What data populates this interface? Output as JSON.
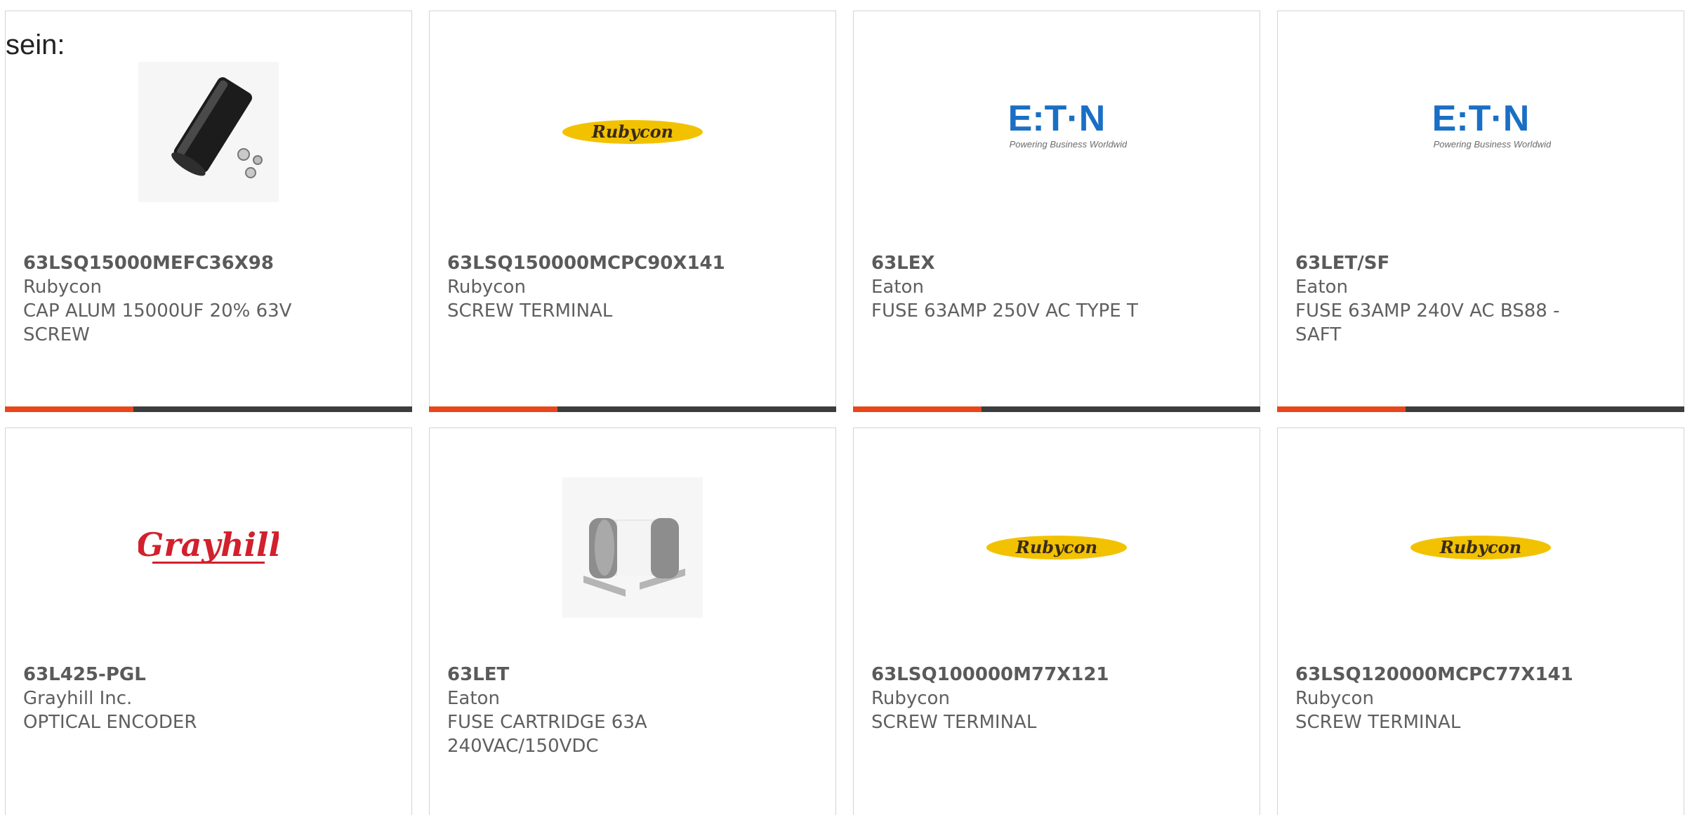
{
  "lead_text": "sein:",
  "products": [
    {
      "part": "63LSQ15000MEFC36X98",
      "manufacturer": "Rubycon",
      "description": "CAP ALUM 15000UF 20% 63V SCREW",
      "image": "capacitor-photo"
    },
    {
      "part": "63LSQ150000MCPC90X141",
      "manufacturer": "Rubycon",
      "description": "SCREW TERMINAL",
      "image": "rubycon-logo",
      "logo_text": "Rubycon"
    },
    {
      "part": "63LEX",
      "manufacturer": "Eaton",
      "description": "FUSE 63AMP 250V AC TYPE T",
      "image": "eaton-logo",
      "logo_text": "E:T·N",
      "logo_tagline": "Powering Business Worldwide"
    },
    {
      "part": "63LET/SF",
      "manufacturer": "Eaton",
      "description": "FUSE 63AMP 240V AC BS88 - SAFT",
      "image": "eaton-logo",
      "logo_text": "E:T·N",
      "logo_tagline": "Powering Business Worldwide"
    },
    {
      "part": "63L425-PGL",
      "manufacturer": "Grayhill Inc.",
      "description": "OPTICAL ENCODER",
      "image": "grayhill-logo",
      "logo_text": "Grayhill"
    },
    {
      "part": "63LET",
      "manufacturer": "Eaton",
      "description": "FUSE CARTRIDGE 63A 240VAC/150VDC",
      "image": "fuse-photo"
    },
    {
      "part": "63LSQ100000M77X121",
      "manufacturer": "Rubycon",
      "description": "SCREW TERMINAL",
      "image": "rubycon-logo",
      "logo_text": "Rubycon"
    },
    {
      "part": "63LSQ120000MCPC77X141",
      "manufacturer": "Rubycon",
      "description": "SCREW TERMINAL",
      "image": "rubycon-logo",
      "logo_text": "Rubycon"
    }
  ],
  "colors": {
    "accent": "#e8461b",
    "stripe": "#3d3d3d",
    "eaton_blue": "#1a6fc4",
    "rubycon_yellow": "#f2c200",
    "grayhill_red": "#d2202c"
  }
}
